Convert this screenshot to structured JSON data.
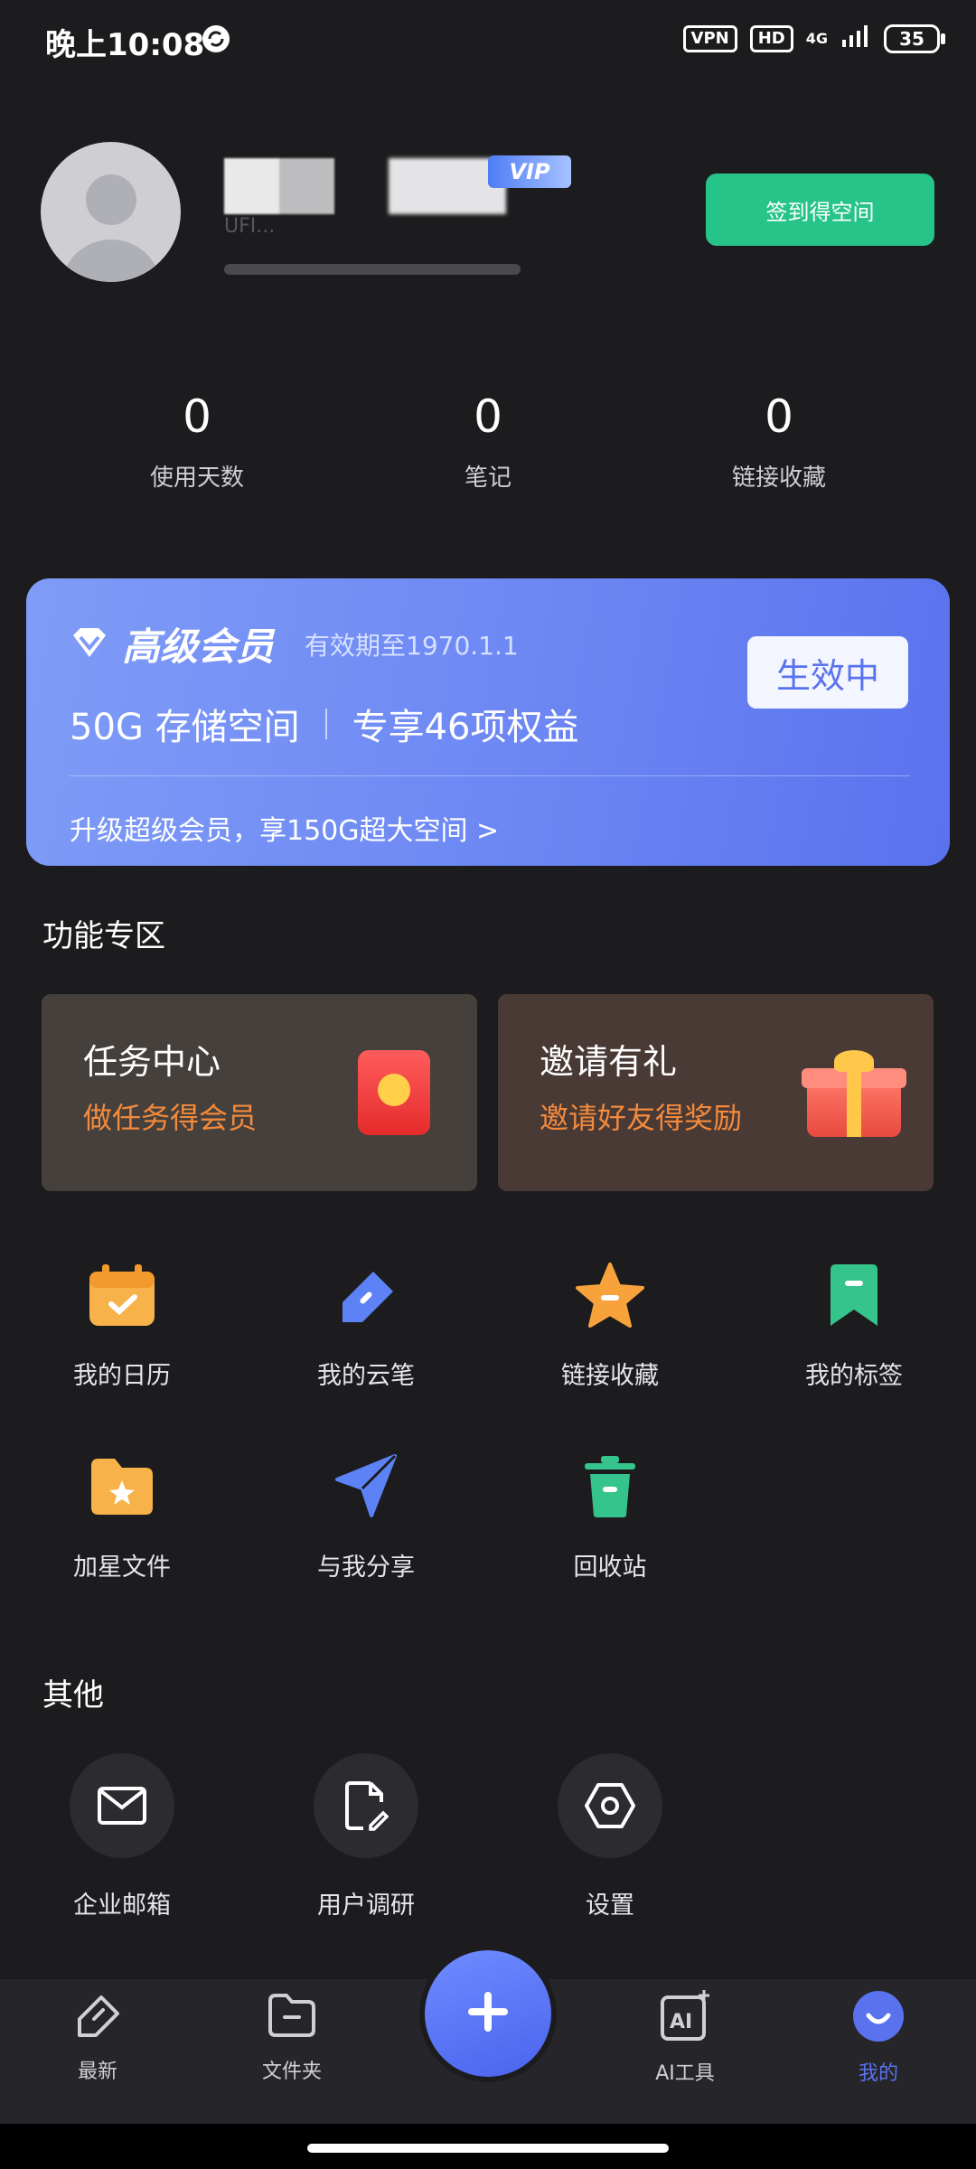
{
  "status_bar": {
    "time": "晚上10:08",
    "vpn": "VPN",
    "hd": "HD",
    "network": "4G",
    "battery": "35"
  },
  "profile": {
    "uid_partial": "UFI...",
    "vip_badge": "VIP",
    "signin_button": "签到得空间"
  },
  "stats": [
    {
      "value": "0",
      "label": "使用天数"
    },
    {
      "value": "0",
      "label": "笔记"
    },
    {
      "value": "0",
      "label": "链接收藏"
    }
  ],
  "vip_card": {
    "title": "高级会员",
    "expiry": "有效期至1970.1.1",
    "storage": "50G 存储空间",
    "benefits": "专享46项权益",
    "status_button": "生效中",
    "upgrade_text": "升级超级会员，享150G超大空间 >"
  },
  "features_section": {
    "title": "功能专区",
    "cards": [
      {
        "title": "任务中心",
        "subtitle": "做任务得会员"
      },
      {
        "title": "邀请有礼",
        "subtitle": "邀请好友得奖励"
      }
    ]
  },
  "grid": [
    {
      "label": "我的日历",
      "icon": "calendar-icon"
    },
    {
      "label": "我的云笔",
      "icon": "pen-icon"
    },
    {
      "label": "链接收藏",
      "icon": "star-icon"
    },
    {
      "label": "我的标签",
      "icon": "bookmark-icon"
    },
    {
      "label": "加星文件",
      "icon": "starred-folder-icon"
    },
    {
      "label": "与我分享",
      "icon": "share-icon"
    },
    {
      "label": "回收站",
      "icon": "trash-icon"
    }
  ],
  "other_section": {
    "title": "其他",
    "items": [
      {
        "label": "企业邮箱",
        "icon": "mail-icon"
      },
      {
        "label": "用户调研",
        "icon": "survey-icon"
      },
      {
        "label": "设置",
        "icon": "settings-icon"
      }
    ]
  },
  "bottom_nav": [
    {
      "label": "最新",
      "icon": "pen-tag-icon"
    },
    {
      "label": "文件夹",
      "icon": "folder-icon"
    },
    {
      "label": "AI工具",
      "icon": "ai-icon"
    },
    {
      "label": "我的",
      "icon": "smile-icon"
    }
  ],
  "colors": {
    "background": "#1c1c1e",
    "accent_green": "#27c48a",
    "accent_blue": "#5a72ee",
    "orange": "#f38a3c"
  }
}
